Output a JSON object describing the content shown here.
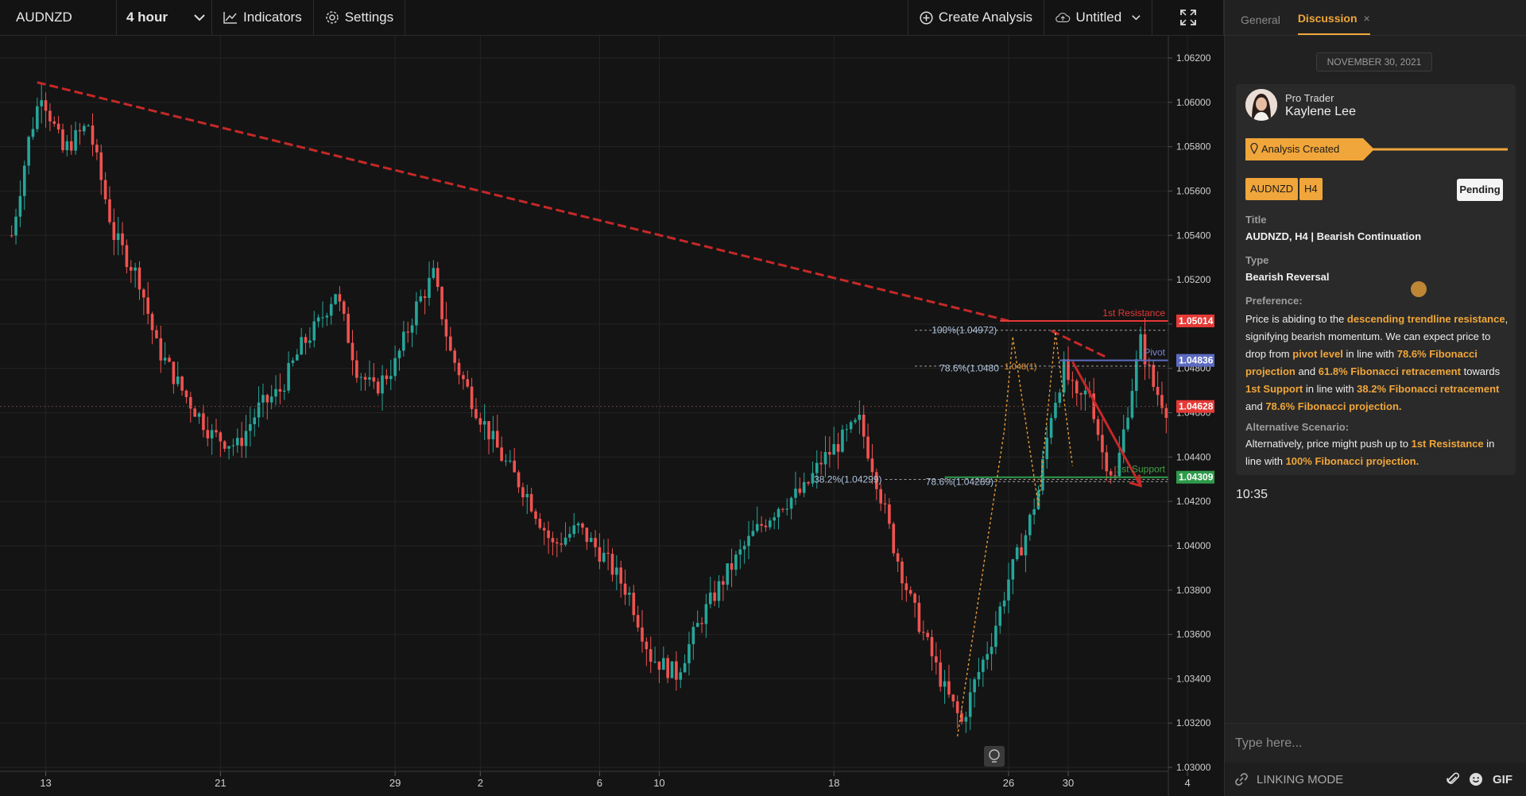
{
  "toolbar": {
    "symbol": "AUDNZD",
    "timeframe": "4 hour",
    "indicators_label": "Indicators",
    "settings_label": "Settings",
    "create_analysis_label": "Create Analysis",
    "layout_name": "Untitled"
  },
  "chart": {
    "type": "candlestick",
    "colors": {
      "up": "#26a69a",
      "down": "#ef5350",
      "trendline": "#c62828",
      "fib": "#e69a3a"
    },
    "price_axis": [
      "1.06200",
      "1.06000",
      "1.05800",
      "1.05600",
      "1.05400",
      "1.05200",
      "1.05000",
      "1.04800",
      "1.04600",
      "1.04400",
      "1.04200",
      "1.04000",
      "1.03800",
      "1.03600",
      "1.03400",
      "1.03200",
      "1.03000"
    ],
    "price_min": 1.03,
    "price_max": 1.062,
    "time_axis": [
      "13",
      "21",
      "29",
      "2",
      "6",
      "10",
      "18",
      "26",
      "30",
      "4"
    ],
    "series_path": [
      [
        0,
        1.054
      ],
      [
        4,
        1.0583
      ],
      [
        7,
        1.0605
      ],
      [
        12,
        1.0578
      ],
      [
        18,
        1.059
      ],
      [
        24,
        1.054
      ],
      [
        30,
        1.052
      ],
      [
        34,
        1.049
      ],
      [
        40,
        1.047
      ],
      [
        47,
        1.045
      ],
      [
        53,
        1.0445
      ],
      [
        58,
        1.0462
      ],
      [
        63,
        1.047
      ],
      [
        68,
        1.049
      ],
      [
        72,
        1.05
      ],
      [
        76,
        1.0515
      ],
      [
        81,
        1.048
      ],
      [
        85,
        1.047
      ],
      [
        90,
        1.0482
      ],
      [
        95,
        1.0508
      ],
      [
        99,
        1.0522
      ],
      [
        103,
        1.0487
      ],
      [
        109,
        1.0462
      ],
      [
        115,
        1.044
      ],
      [
        121,
        1.0423
      ],
      [
        127,
        1.04
      ],
      [
        133,
        1.0408
      ],
      [
        139,
        1.0395
      ],
      [
        145,
        1.0378
      ],
      [
        150,
        1.035
      ],
      [
        156,
        1.0342
      ],
      [
        162,
        1.0368
      ],
      [
        168,
        1.0388
      ],
      [
        174,
        1.0405
      ],
      [
        180,
        1.0418
      ],
      [
        186,
        1.0425
      ],
      [
        190,
        1.0438
      ],
      [
        195,
        1.0448
      ],
      [
        199,
        1.0456
      ],
      [
        203,
        1.043
      ],
      [
        207,
        1.04
      ],
      [
        211,
        1.0375
      ],
      [
        215,
        1.0355
      ],
      [
        219,
        1.0335
      ],
      [
        223,
        1.032
      ],
      [
        226,
        1.0338
      ],
      [
        230,
        1.0358
      ],
      [
        234,
        1.0385
      ],
      [
        238,
        1.0405
      ],
      [
        241,
        1.0425
      ],
      [
        244,
        1.046
      ],
      [
        247,
        1.048
      ],
      [
        250,
        1.0465
      ],
      [
        253,
        1.047
      ],
      [
        256,
        1.0442
      ],
      [
        259,
        1.043
      ],
      [
        262,
        1.0462
      ],
      [
        265,
        1.0492
      ],
      [
        268,
        1.0472
      ],
      [
        271,
        1.0462
      ]
    ],
    "price_labels": {
      "resistance": "1.05014",
      "pivot": "1.04836",
      "current": "1.04628",
      "support": "1.04309"
    },
    "level_labels": {
      "resistance": "1st Resistance",
      "pivot": "Pivot",
      "support": "1st Support"
    },
    "fib_labels": {
      "p100": "100%(1.04972)",
      "p786": "78.6%(1.0480",
      "p786b": "1.048(1)",
      "p382": "38.2%(1.04299)",
      "p786c": "78.6%(1.04289)"
    }
  },
  "panel": {
    "tabs": [
      {
        "label": "General"
      },
      {
        "label": "Discussion"
      }
    ],
    "close_icon": "×",
    "date": "NOVEMBER 30, 2021",
    "author_role": "Pro Trader",
    "author_name": "Kaylene Lee",
    "banner": "Analysis Created",
    "tags": [
      "AUDNZD",
      "H4"
    ],
    "status": "Pending",
    "title_label": "Title",
    "title_value": "AUDNZD, H4 | Bearish Continuation",
    "type_label": "Type",
    "type_value": "Bearish Reversal",
    "preference_label": "Preference:",
    "preference_parts": [
      "Price is abiding to the ",
      "descending trendline resistance",
      ", signifying bearish momentum. We can expect price to drop from ",
      "pivot level",
      " in line with ",
      "78.6% Fibonacci projection",
      " and ",
      "61.8% Fibonacci retracement",
      " towards ",
      "1st Support",
      " in line with ",
      "38.2% Fibonacci retracement",
      " and ",
      "78.6% Fibonacci projection."
    ],
    "alt_label": "Alternative Scenario:",
    "alt_parts": [
      "Alternatively, price might push up to ",
      "1st Resistance",
      " in line with ",
      "100% Fibonacci projection."
    ],
    "time": "10:35",
    "input_placeholder": "Type here...",
    "linking_mode": "LINKING MODE",
    "gif_label": "GIF"
  },
  "icons": {
    "chevron": "chevron-down-icon",
    "indicators": "chart-line-icon",
    "settings": "gear-icon",
    "create": "plus-circle-icon",
    "cloud": "cloud-upload-icon",
    "fullscreen": "fullscreen-icon",
    "pin": "location-pin-icon",
    "link": "link-icon",
    "attach": "paperclip-icon",
    "emoji": "emoji-icon",
    "bulb": "lightbulb-icon"
  }
}
